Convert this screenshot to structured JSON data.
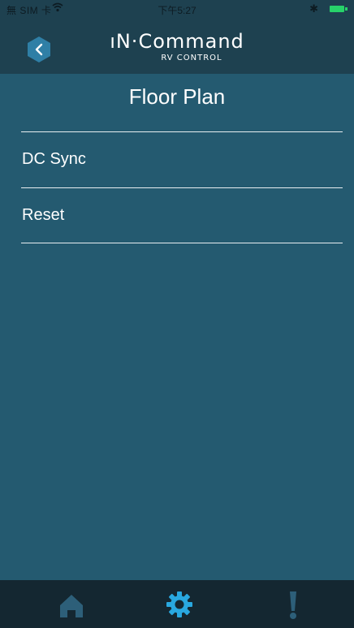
{
  "status_bar": {
    "carrier": "無 SIM 卡",
    "time": "下午5:27"
  },
  "header": {
    "logo_main": "ıN·Command",
    "logo_sub": "RV CONTROL"
  },
  "page": {
    "title": "Floor Plan"
  },
  "menu": {
    "items": [
      {
        "label": "DC Sync"
      },
      {
        "label": "Reset"
      }
    ]
  },
  "tab_bar": {
    "tabs": [
      {
        "icon": "home-icon",
        "active": false
      },
      {
        "icon": "gear-icon",
        "active": true
      },
      {
        "icon": "alert-icon",
        "active": false
      }
    ]
  },
  "colors": {
    "background": "#245a70",
    "header": "#1e4150",
    "tab_bar": "#142731",
    "accent": "#29a8e0",
    "inactive_tab": "#2d5f79"
  }
}
